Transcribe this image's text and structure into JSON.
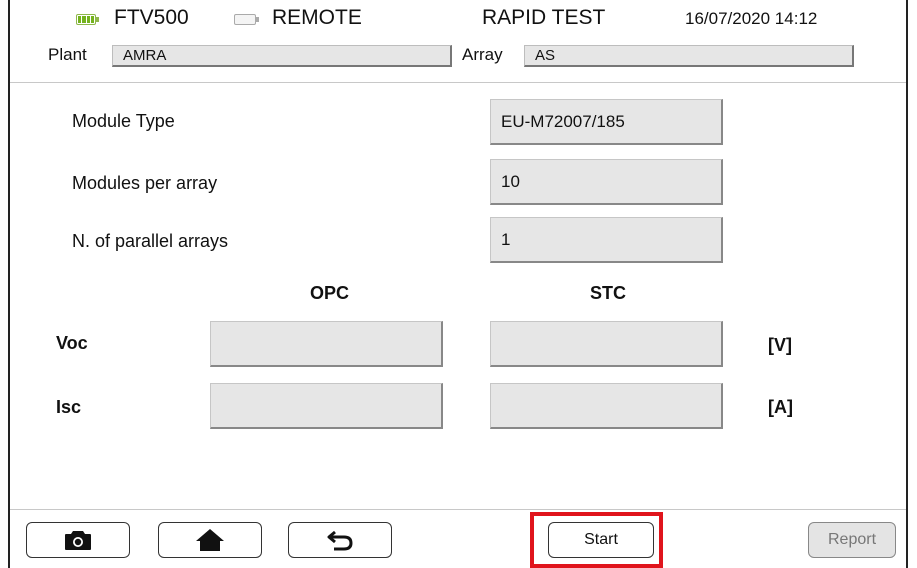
{
  "header": {
    "device": "FTV500",
    "mode": "REMOTE",
    "test_name": "RAPID TEST",
    "datetime": "16/07/2020 14:12",
    "plant_label": "Plant",
    "plant_value": "AMRA",
    "array_label": "Array",
    "array_value": "AS"
  },
  "form": {
    "module_type_label": "Module Type",
    "module_type_value": "EU-M72007/185",
    "modules_per_array_label": "Modules per array",
    "modules_per_array_value": "10",
    "parallel_arrays_label": "N. of parallel arrays",
    "parallel_arrays_value": "1"
  },
  "measurements": {
    "col_opc": "OPC",
    "col_stc": "STC",
    "rows": [
      {
        "label": "Voc",
        "opc": "",
        "stc": "",
        "unit": "[V]"
      },
      {
        "label": "Isc",
        "opc": "",
        "stc": "",
        "unit": "[A]"
      }
    ]
  },
  "toolbar": {
    "camera_icon": "camera-icon",
    "home_icon": "home-icon",
    "back_icon": "back-arrow-icon",
    "start_label": "Start",
    "report_label": "Report"
  },
  "colors": {
    "highlight": "#e0141c",
    "battery": "#74b21e"
  }
}
